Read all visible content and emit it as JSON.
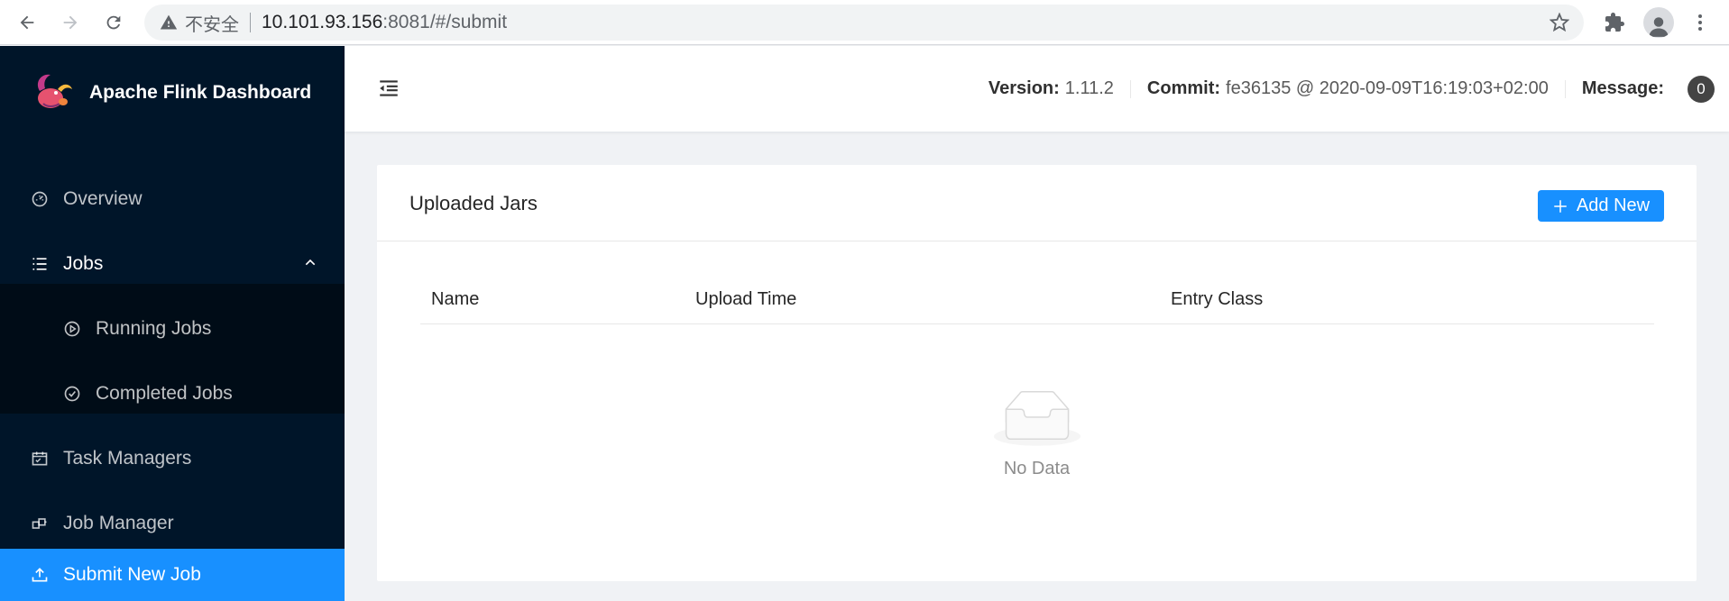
{
  "browser": {
    "insecure_label": "不安全",
    "url_host": "10.101.93.156",
    "url_rest": ":8081/#/submit"
  },
  "app": {
    "title": "Apache Flink Dashboard"
  },
  "sidebar": {
    "items": [
      {
        "label": "Overview",
        "icon": "dashboard-icon"
      },
      {
        "label": "Jobs",
        "icon": "list-icon"
      },
      {
        "label": "Running Jobs",
        "icon": "play-circle-icon"
      },
      {
        "label": "Completed Jobs",
        "icon": "check-circle-icon"
      },
      {
        "label": "Task Managers",
        "icon": "schedule-icon"
      },
      {
        "label": "Job Manager",
        "icon": "cluster-icon"
      },
      {
        "label": "Submit New Job",
        "icon": "upload-icon"
      }
    ],
    "active": "Submit New Job"
  },
  "header": {
    "version_key": "Version:",
    "version_value": "1.11.2",
    "commit_key": "Commit:",
    "commit_value": "fe36135 @ 2020-09-09T16:19:03+02:00",
    "message_key": "Message:",
    "message_count": "0"
  },
  "card": {
    "title": "Uploaded Jars",
    "add_button": "Add New",
    "columns": [
      "Name",
      "Upload Time",
      "Entry Class"
    ],
    "empty_text": "No Data"
  },
  "colors": {
    "sidebar_bg": "#001529",
    "submenu_bg": "#000c17",
    "accent": "#1890ff"
  }
}
